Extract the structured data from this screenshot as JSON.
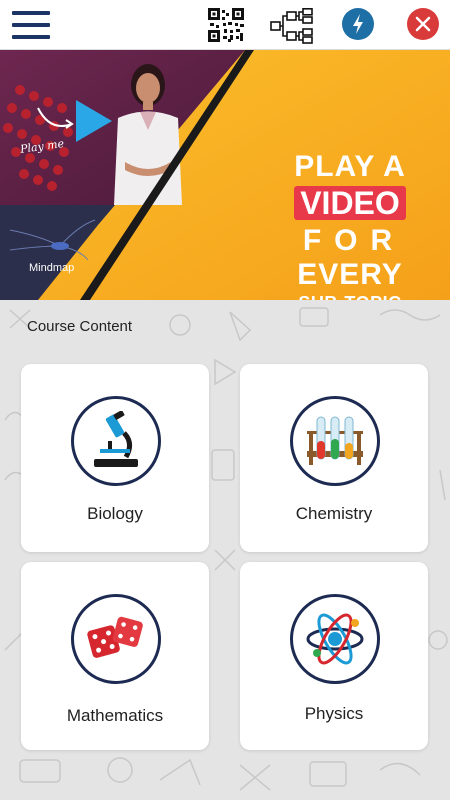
{
  "topbar": {
    "menu_icon": "hamburger-menu-icon",
    "qr_icon": "qr-code-icon",
    "tree_icon": "tree-diagram-icon",
    "bolt_icon": "lightning-bolt-icon",
    "close_icon": "close-icon",
    "bolt_color": "#1d6fa5",
    "close_color": "#d93b3b"
  },
  "banner": {
    "play_me": "Play me",
    "mindmap_label": "Mindmap",
    "promo": {
      "line1": "PLAY A",
      "line2": "VIDEO",
      "line3": "FOR",
      "line4": "EVERY",
      "line5": "SUB-TOPIC"
    },
    "accent": "#f7a71e"
  },
  "content": {
    "title": "Course Content",
    "subjects": [
      {
        "name": "Biology",
        "icon": "microscope-icon"
      },
      {
        "name": "Chemistry",
        "icon": "test-tubes-icon"
      },
      {
        "name": "Mathematics",
        "icon": "dice-icon"
      },
      {
        "name": "Physics",
        "icon": "atom-icon"
      }
    ]
  }
}
